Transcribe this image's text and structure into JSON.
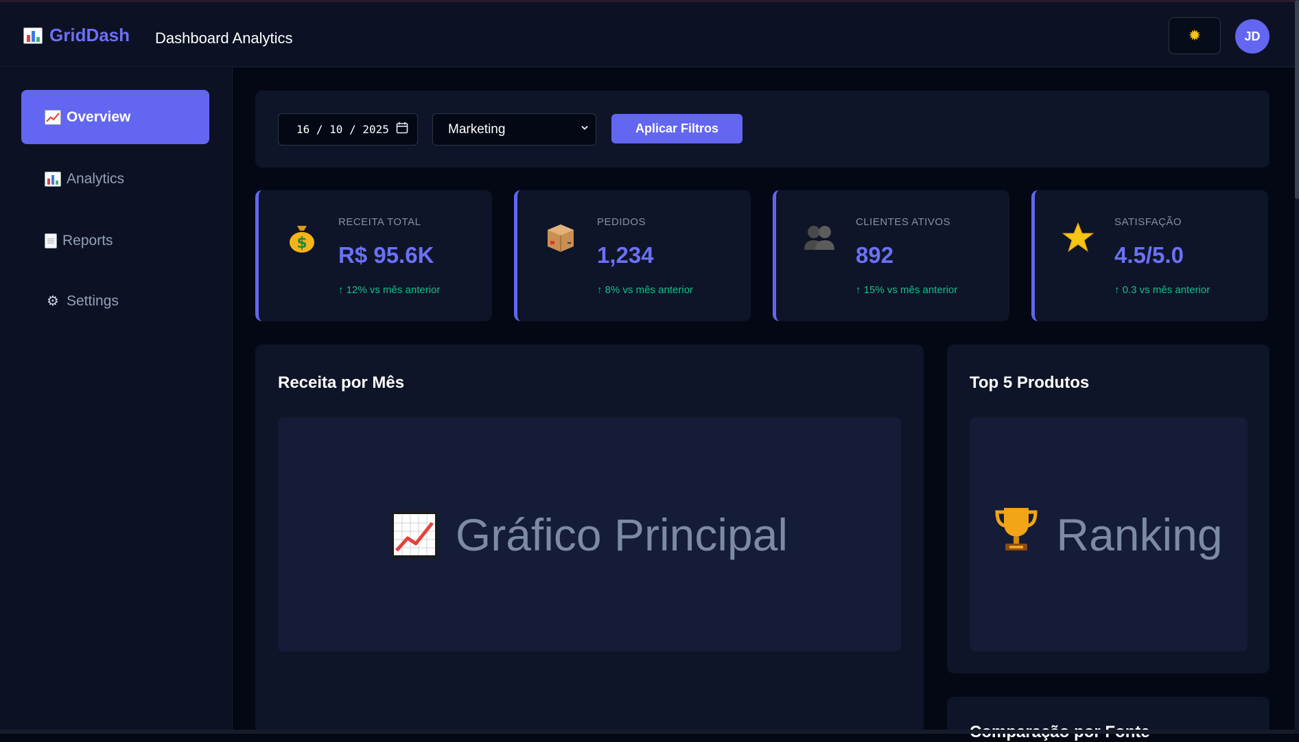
{
  "app": {
    "brand": "GridDash",
    "page_title": "Dashboard Analytics"
  },
  "header": {
    "theme_toggle_icon": "sun-icon",
    "avatar_initials": "JD"
  },
  "sidebar": {
    "items": [
      {
        "label": "Overview",
        "icon": "chart-increasing-icon",
        "active": true
      },
      {
        "label": "Analytics",
        "icon": "bar-chart-icon",
        "active": false
      },
      {
        "label": "Reports",
        "icon": "document-icon",
        "active": false
      },
      {
        "label": "Settings",
        "icon": "gear-icon",
        "active": false
      }
    ]
  },
  "filters": {
    "date_value": "16 / 10 / 2025",
    "department_selected": "Marketing",
    "apply_label": "Aplicar Filtros"
  },
  "kpis": [
    {
      "label": "RECEITA TOTAL",
      "value": "R$ 95.6K",
      "change": "↑ 12% vs mês anterior",
      "icon": "money-bag-icon"
    },
    {
      "label": "PEDIDOS",
      "value": "1,234",
      "change": "↑ 8% vs mês anterior",
      "icon": "package-icon"
    },
    {
      "label": "CLIENTES ATIVOS",
      "value": "892",
      "change": "↑ 15% vs mês anterior",
      "icon": "users-icon"
    },
    {
      "label": "SATISFAÇÃO",
      "value": "4.5/5.0",
      "change": "↑ 0.3 vs mês anterior",
      "icon": "star-icon"
    }
  ],
  "panels": {
    "revenue": {
      "title": "Receita por Mês",
      "placeholder": "Gráfico Principal"
    },
    "ranking": {
      "title": "Top 5 Produtos",
      "placeholder": "Ranking"
    },
    "third": {
      "title": "Comparação por Fonte"
    }
  },
  "colors": {
    "accent": "#6366f1",
    "positive": "#13c08a",
    "background": "#030814",
    "panel": "#0e1528"
  }
}
